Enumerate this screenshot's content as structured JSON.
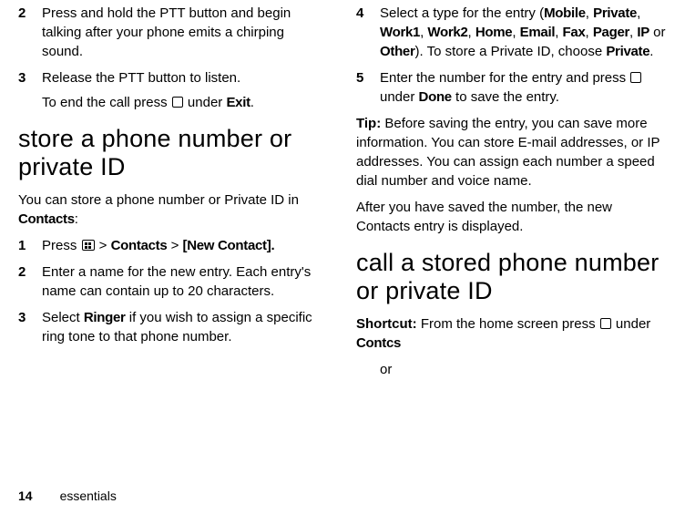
{
  "left": {
    "step2": {
      "num": "2",
      "text": "Press and hold the PTT button and begin talking after your phone emits a chirping sound."
    },
    "step3": {
      "num": "3",
      "line1": "Release the PTT button to listen.",
      "line2a": "To end the call press ",
      "line2b": " under ",
      "exit": "Exit",
      "period": "."
    },
    "heading": "store a phone number or private ID",
    "intro_a": "You can store a phone number or Private ID in ",
    "contacts": "Contacts",
    "intro_b": ":",
    "s1": {
      "num": "1",
      "a": "Press ",
      "b": " > ",
      "contacts": "Contacts",
      "c": " > ",
      "newcontact": "[New Contact]."
    },
    "s2": {
      "num": "2",
      "text": "Enter a name for the new entry. Each entry's name can contain up to 20 characters."
    },
    "s3": {
      "num": "3",
      "a": "Select ",
      "ringer": "Ringer",
      "b": " if you wish to assign a specific ring tone to that phone number."
    }
  },
  "right": {
    "s4": {
      "num": "4",
      "a": "Select a type for the entry (",
      "mobile": "Mobile",
      "private": "Private",
      "work1": "Work1",
      "work2": "Work2",
      "home": "Home",
      "email": "Email",
      "fax": "Fax",
      "pager": "Pager",
      "ip": "IP",
      "other": "Other",
      "b": "). To store a Private ID, choose ",
      "private2": "Private",
      "c": "."
    },
    "s5": {
      "num": "5",
      "a": "Enter the number for the entry and press ",
      "b": " under ",
      "done": "Done",
      "c": " to save the entry."
    },
    "tip_label": "Tip:",
    "tip_text": " Before saving the entry, you can save more information. You can store E-mail addresses, or IP addresses. You can assign each number a speed dial number and voice name.",
    "after": "After you have saved the number, the new Contacts entry is displayed.",
    "heading": "call a stored phone number or private ID",
    "shortcut_label": "Shortcut:",
    "shortcut_a": " From the home screen press ",
    "shortcut_b": " under ",
    "contcs": "Contcs",
    "or": "or"
  },
  "footer": {
    "page": "14",
    "section": "essentials"
  }
}
